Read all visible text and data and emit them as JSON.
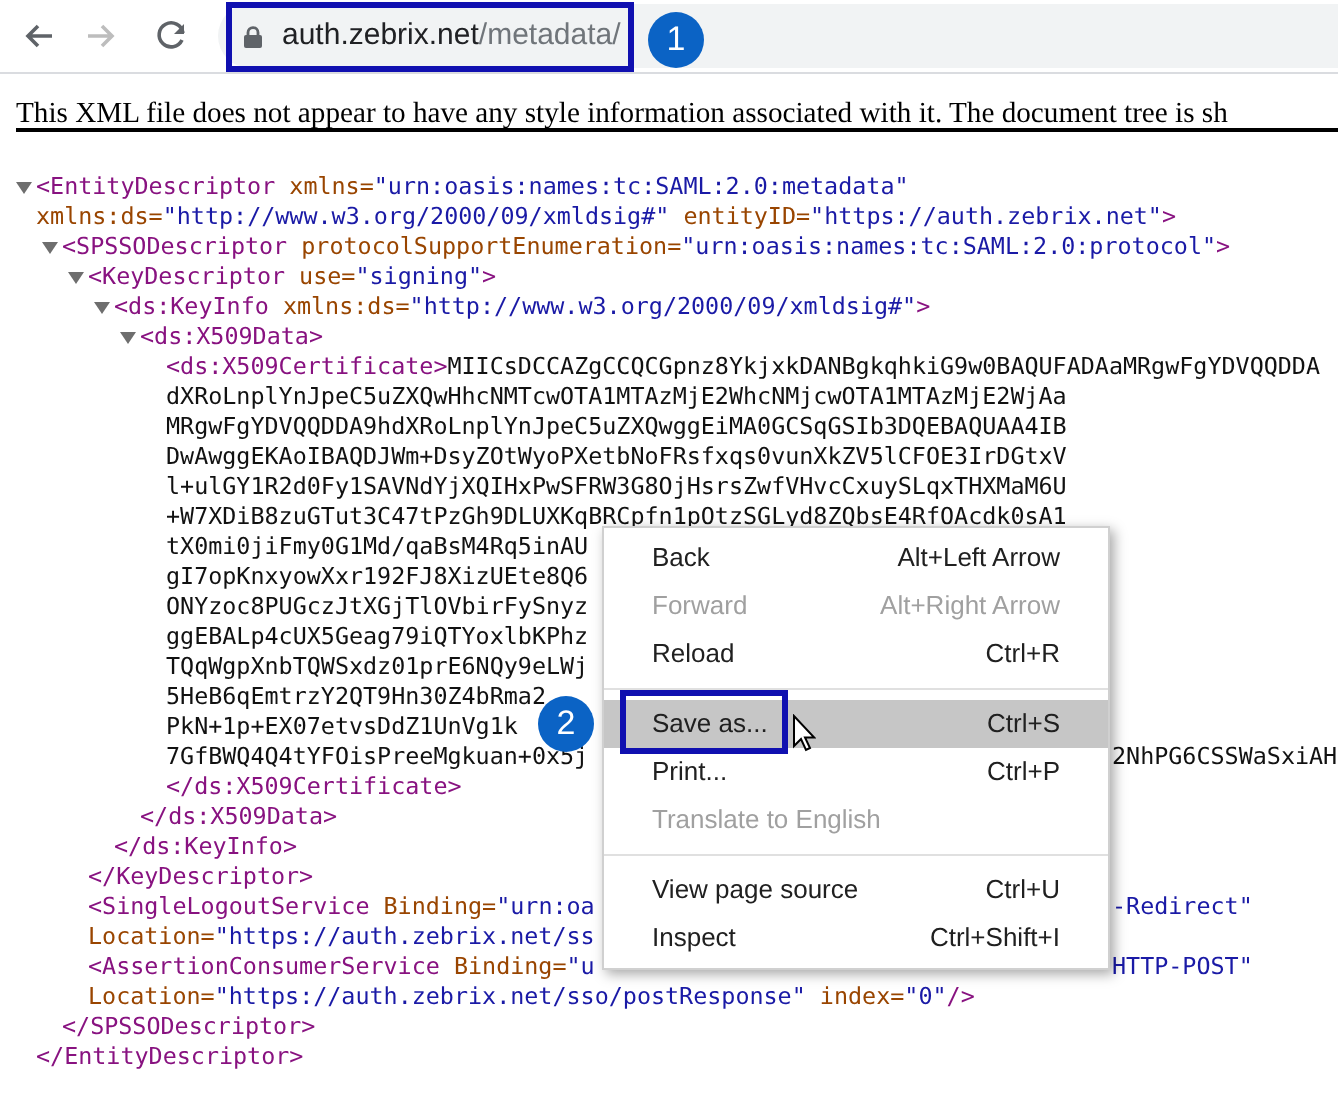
{
  "nav_buttons": [
    {
      "kind": "back",
      "disabled": false
    },
    {
      "kind": "forward",
      "disabled": true
    },
    {
      "kind": "reload",
      "disabled": false
    }
  ],
  "address_bar": {
    "host": "auth.zebrix.net",
    "path": "/metadata/"
  },
  "callouts": [
    {
      "number": "1"
    },
    {
      "number": "2"
    }
  ],
  "notice": "This XML file does not appear to have any style information associated with it. The document tree is sh",
  "xml_tree": {
    "expanded": true,
    "lines": [
      {
        "tokens": [
          {
            "kind": "tag",
            "text": "<EntityDescriptor"
          },
          {
            "kind": "attr",
            "text": " xmlns="
          },
          {
            "kind": "value",
            "text": "\"urn:oasis:names:tc:SAML:2.0:metadata\""
          }
        ]
      },
      {
        "tokens": [
          {
            "kind": "attr",
            "text": "xmlns:ds="
          },
          {
            "kind": "value",
            "text": "\"http://www.w3.org/2000/09/xmldsig#\""
          },
          {
            "kind": "attr",
            "text": " entityID="
          },
          {
            "kind": "value",
            "text": "\"https://auth.zebrix.net\""
          },
          {
            "kind": "tag",
            "text": ">"
          }
        ]
      }
    ],
    "children": [
      {
        "expanded": true,
        "lines": [
          {
            "tokens": [
              {
                "kind": "tag",
                "text": "<SPSSODescriptor"
              },
              {
                "kind": "attr",
                "text": " protocolSupportEnumeration="
              },
              {
                "kind": "value",
                "text": "\"urn:oasis:names:tc:SAML:2.0:protocol\""
              },
              {
                "kind": "tag",
                "text": ">"
              }
            ]
          }
        ],
        "children": [
          {
            "expanded": true,
            "lines": [
              {
                "tokens": [
                  {
                    "kind": "tag",
                    "text": "<KeyDescriptor"
                  },
                  {
                    "kind": "attr",
                    "text": " use="
                  },
                  {
                    "kind": "value",
                    "text": "\"signing\""
                  },
                  {
                    "kind": "tag",
                    "text": ">"
                  }
                ]
              }
            ],
            "children": [
              {
                "expanded": true,
                "lines": [
                  {
                    "tokens": [
                      {
                        "kind": "tag",
                        "text": "<ds:KeyInfo"
                      },
                      {
                        "kind": "attr",
                        "text": " xmlns:ds="
                      },
                      {
                        "kind": "value",
                        "text": "\"http://www.w3.org/2000/09/xmldsig#\""
                      },
                      {
                        "kind": "tag",
                        "text": ">"
                      }
                    ]
                  }
                ],
                "children": [
                  {
                    "expanded": true,
                    "lines": [
                      {
                        "tokens": [
                          {
                            "kind": "tag",
                            "text": "<ds:X509Data>"
                          }
                        ]
                      }
                    ],
                    "children": [
                      {
                        "lines": [
                          {
                            "tokens": [
                              {
                                "kind": "tag",
                                "text": "<ds:X509Certificate>"
                              },
                              {
                                "kind": "text",
                                "text": "MIICsDCCAZgCCQCGpnz8YkjxkDANBgkqhkiG9w0BAQUFADAaMRgwFgYDVQQDDA"
                              }
                            ]
                          },
                          {
                            "tokens": [
                              {
                                "kind": "text",
                                "text": "dXRoLnplYnJpeC5uZXQwHhcNMTcwOTA1MTAzMjE2WhcNMjcwOTA1MTAzMjE2WjAa"
                              }
                            ]
                          },
                          {
                            "tokens": [
                              {
                                "kind": "text",
                                "text": "MRgwFgYDVQQDDA9hdXRoLnplYnJpeC5uZXQwggEiMA0GCSqGSIb3DQEBAQUAA4IB"
                              }
                            ]
                          },
                          {
                            "tokens": [
                              {
                                "kind": "text",
                                "text": "DwAwggEKAoIBAQDJWm+DsyZOtWyoPXetbNoFRsfxqs0vunXkZV5lCFOE3IrDGtxV"
                              }
                            ]
                          },
                          {
                            "tokens": [
                              {
                                "kind": "text",
                                "text": "l+ulGY1R2d0Fy1SAVNdYjXQIHxPwSFRW3G8OjHsrsZwfVHvcCxuySLqxTHXMaM6U"
                              }
                            ]
                          },
                          {
                            "tokens": [
                              {
                                "kind": "text",
                                "text": "+W7XDiB8zuGTut3C47tPzGh9DLUXKqBRCpfn1pOtzSGLyd8ZQbsE4RfOAcdk0sA1"
                              }
                            ]
                          },
                          {
                            "tokens": [
                              {
                                "kind": "text",
                                "text": "tX0mi0jiFmy0G1Md/qaBsM4Rq5inAU"
                              }
                            ]
                          },
                          {
                            "tokens": [
                              {
                                "kind": "text",
                                "text": "gI7opKnxyowXxr192FJ8XizUEte8Q6"
                              }
                            ]
                          },
                          {
                            "tokens": [
                              {
                                "kind": "text",
                                "text": "ONYzoc8PUGczJtXGjTlOVbirFySnyz"
                              }
                            ]
                          },
                          {
                            "tokens": [
                              {
                                "kind": "text",
                                "text": "ggEBALp4cUX5Geag79iQTYoxlbKPhz"
                              }
                            ]
                          },
                          {
                            "tokens": [
                              {
                                "kind": "text",
                                "text": "TQqWgpXnbTQWSxdz01prE6NQy9eLWj"
                              }
                            ]
                          },
                          {
                            "tokens": [
                              {
                                "kind": "text",
                                "text": "5HeB6qEmtrzY2QT9Hn30Z4bRma2"
                              }
                            ]
                          },
                          {
                            "tokens": [
                              {
                                "kind": "text",
                                "text": "PkN+1p+EX07etvsDdZ1UnVg1k"
                              }
                            ]
                          },
                          {
                            "tokens": [
                              {
                                "kind": "text",
                                "text": "7GfBWQ4Q4tYFOisPreeMgkuan+0x5j"
                              }
                            ],
                            "after_menu": [
                              {
                                "kind": "text",
                                "text": "2NhPG6CSSWaSxiAH"
                              }
                            ]
                          }
                        ],
                        "closing": {
                          "tokens": [
                            {
                              "kind": "tag",
                              "text": "</ds:X509Certificate>"
                            }
                          ]
                        }
                      }
                    ],
                    "closing": {
                      "tokens": [
                        {
                          "kind": "tag",
                          "text": "</ds:X509Data>"
                        }
                      ]
                    }
                  }
                ],
                "closing": {
                  "tokens": [
                    {
                      "kind": "tag",
                      "text": "</ds:KeyInfo>"
                    }
                  ]
                }
              }
            ],
            "closing": {
              "tokens": [
                {
                  "kind": "tag",
                  "text": "</KeyDescriptor>"
                }
              ]
            }
          },
          {
            "lines": [
              {
                "tokens": [
                  {
                    "kind": "tag",
                    "text": "<SingleLogoutService"
                  },
                  {
                    "kind": "attr",
                    "text": " Binding="
                  },
                  {
                    "kind": "value",
                    "text": "\"urn:oa"
                  }
                ],
                "after_menu": [
                  {
                    "kind": "value",
                    "text": "-Redirect\""
                  }
                ]
              },
              {
                "tokens": [
                  {
                    "kind": "attr",
                    "text": "Location="
                  },
                  {
                    "kind": "value",
                    "text": "\"https://auth.zebrix.net/ss"
                  }
                ]
              }
            ]
          },
          {
            "lines": [
              {
                "tokens": [
                  {
                    "kind": "tag",
                    "text": "<AssertionConsumerService"
                  },
                  {
                    "kind": "attr",
                    "text": " Binding="
                  },
                  {
                    "kind": "value",
                    "text": "\"u"
                  }
                ],
                "after_menu": [
                  {
                    "kind": "value",
                    "text": "HTTP-POST\""
                  }
                ]
              },
              {
                "tokens": [
                  {
                    "kind": "attr",
                    "text": "Location="
                  },
                  {
                    "kind": "value",
                    "text": "\"https://auth.zebrix.net/sso/postResponse\""
                  },
                  {
                    "kind": "attr",
                    "text": " index="
                  },
                  {
                    "kind": "value",
                    "text": "\"0\""
                  },
                  {
                    "kind": "tag",
                    "text": "/>"
                  }
                ]
              }
            ]
          }
        ],
        "closing": {
          "tokens": [
            {
              "kind": "tag",
              "text": "</SPSSODescriptor>"
            }
          ]
        }
      }
    ],
    "closing": {
      "tokens": [
        {
          "kind": "tag",
          "text": "</EntityDescriptor>"
        }
      ]
    }
  },
  "context_menu": [
    {
      "kind": "item",
      "label": "Back",
      "shortcut": "Alt+Left Arrow",
      "disabled": false,
      "selected": false
    },
    {
      "kind": "item",
      "label": "Forward",
      "shortcut": "Alt+Right Arrow",
      "disabled": true,
      "selected": false
    },
    {
      "kind": "item",
      "label": "Reload",
      "shortcut": "Ctrl+R",
      "disabled": false,
      "selected": false
    },
    {
      "kind": "separator"
    },
    {
      "kind": "item",
      "label": "Save as...",
      "shortcut": "Ctrl+S",
      "disabled": false,
      "selected": true
    },
    {
      "kind": "item",
      "label": "Print...",
      "shortcut": "Ctrl+P",
      "disabled": false,
      "selected": false
    },
    {
      "kind": "item",
      "label": "Translate to English",
      "disabled": true,
      "selected": false
    },
    {
      "kind": "separator"
    },
    {
      "kind": "item",
      "label": "View page source",
      "shortcut": "Ctrl+U",
      "disabled": false,
      "selected": false
    },
    {
      "kind": "item",
      "label": "Inspect",
      "shortcut": "Ctrl+Shift+I",
      "disabled": false,
      "selected": false
    }
  ]
}
